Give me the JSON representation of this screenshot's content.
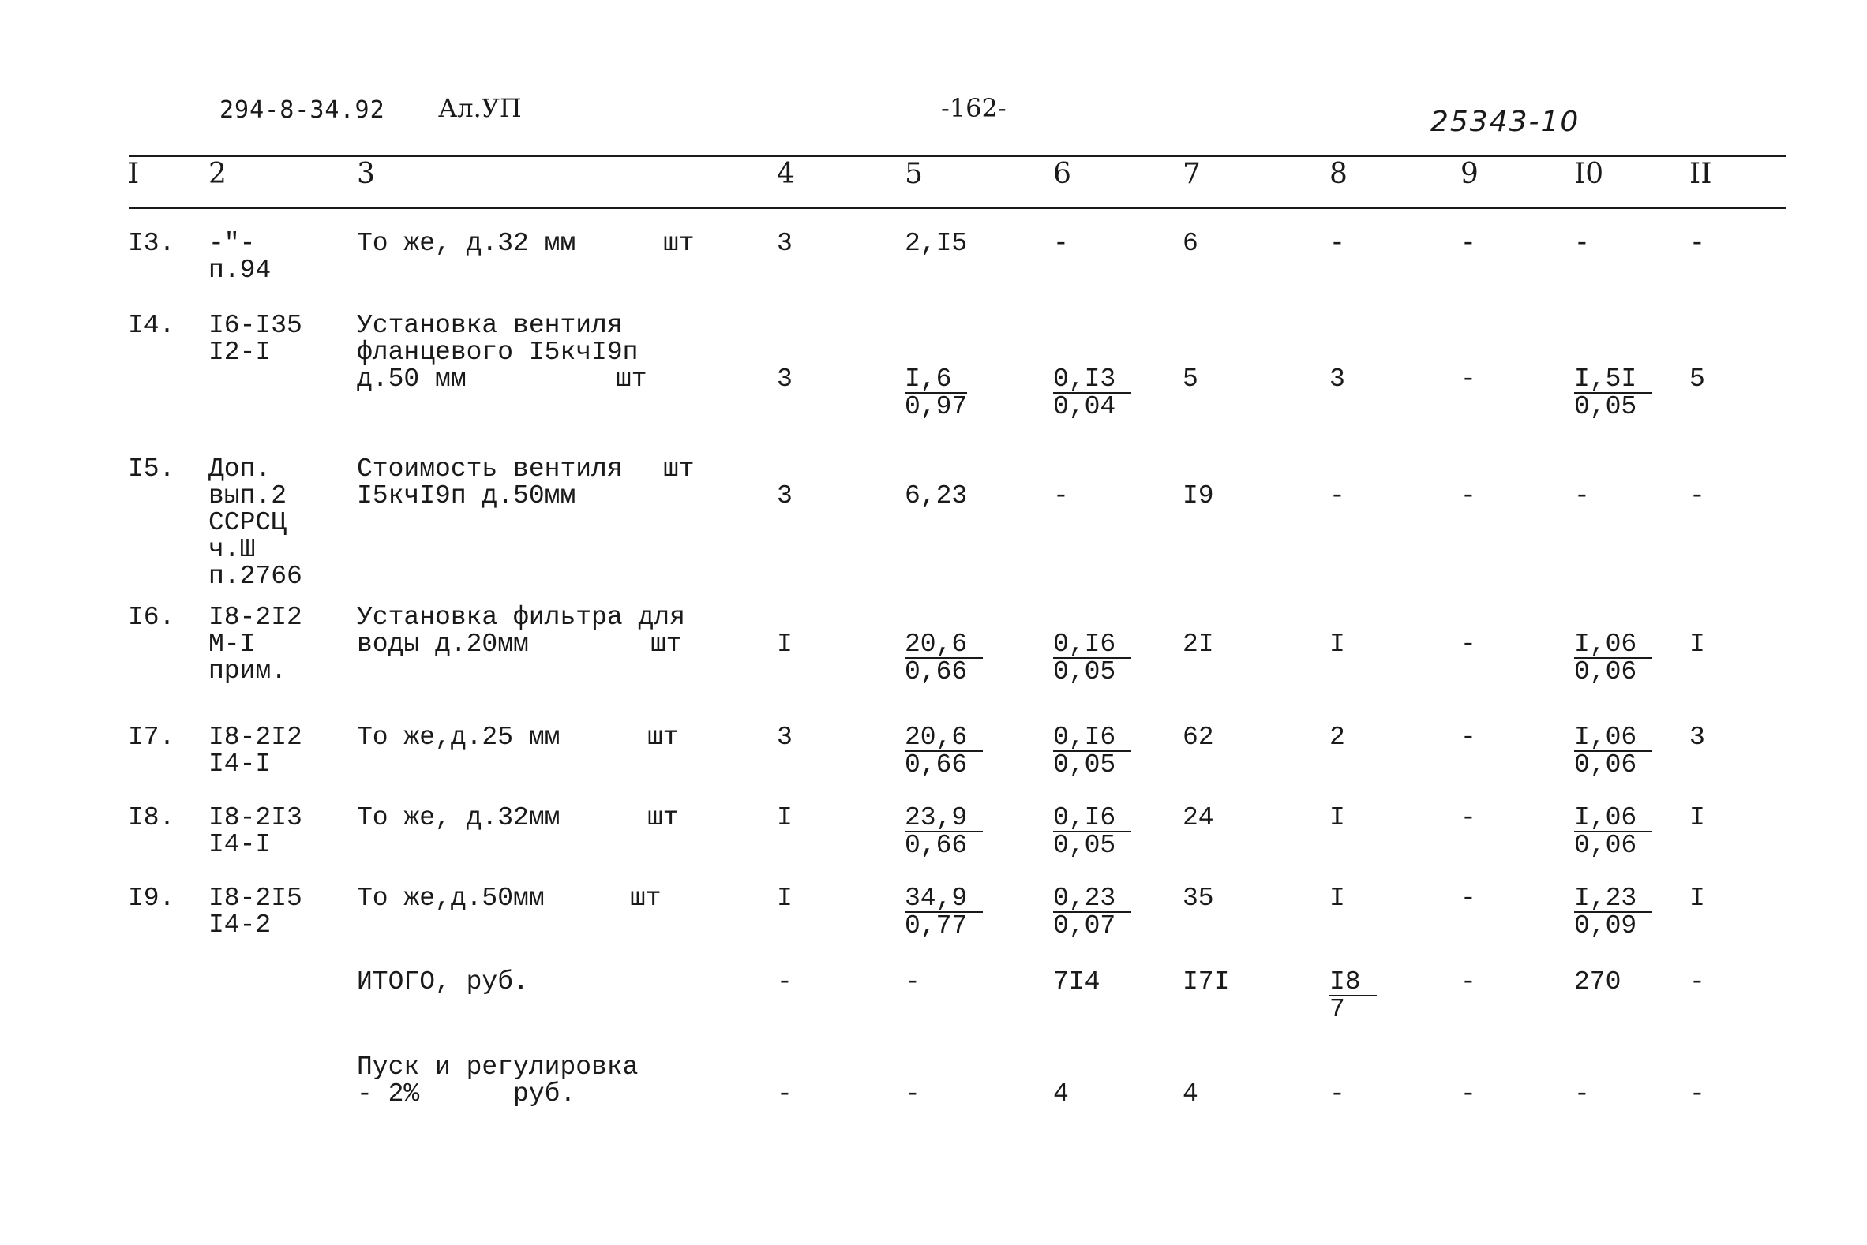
{
  "header": {
    "doc_code": "294-8-34.92",
    "album": "Ал.УП",
    "page_number": "-162-",
    "stamp": "25343-10"
  },
  "columns": [
    "I",
    "2",
    "3",
    "4",
    "5",
    "6",
    "7",
    "8",
    "9",
    "I0",
    "II"
  ],
  "rows": [
    {
      "num": "I3.",
      "ref": [
        "-\"-",
        "п.94"
      ],
      "desc": [
        "То же, д.32 мм"
      ],
      "unit": "шт",
      "c4": "3",
      "c5": {
        "value": "2,I5"
      },
      "c6": {
        "value": "-"
      },
      "c7": "6",
      "c8": {
        "value": "-"
      },
      "c9": "-",
      "c10": {
        "value": "-"
      },
      "c11": "-"
    },
    {
      "num": "I4.",
      "ref": [
        "I6-I35",
        "I2-I"
      ],
      "desc": [
        "Установка вентиля",
        "фланцевого I5кчI9п",
        "д.50 мм"
      ],
      "unit": "шт",
      "c4": "3",
      "c5": {
        "num": "I,6",
        "den": "0,97"
      },
      "c6": {
        "num": "0,I3",
        "den": "0,04"
      },
      "c7": "5",
      "c8": {
        "value": "3"
      },
      "c9": "-",
      "c10": {
        "num": "I,5I",
        "den": "0,05"
      },
      "c11": "5"
    },
    {
      "num": "I5.",
      "ref": [
        "Доп.",
        "вып.2",
        "ССРСЦ",
        "ч.Ш",
        "п.2766"
      ],
      "desc": [
        "Стоимость вентиля",
        "I5кчI9п д.50мм"
      ],
      "unit": "шт",
      "c4": "3",
      "c5": {
        "value": "6,23"
      },
      "c6": {
        "value": "-"
      },
      "c7": "I9",
      "c8": {
        "value": "-"
      },
      "c9": "-",
      "c10": {
        "value": "-"
      },
      "c11": "-"
    },
    {
      "num": "I6.",
      "ref": [
        "I8-2I2",
        "М-I",
        "прим."
      ],
      "desc": [
        "Установка фильтра для",
        "воды д.20мм"
      ],
      "unit": "шт",
      "c4": "I",
      "c5": {
        "num": "20,6",
        "den": "0,66"
      },
      "c6": {
        "num": "0,I6",
        "den": "0,05"
      },
      "c7": "2I",
      "c8": {
        "value": "I"
      },
      "c9": "-",
      "c10": {
        "num": "I,06",
        "den": "0,06"
      },
      "c11": "I"
    },
    {
      "num": "I7.",
      "ref": [
        "I8-2I2",
        "I4-I"
      ],
      "desc": [
        "То же,д.25 мм"
      ],
      "unit": "шт",
      "c4": "3",
      "c5": {
        "num": "20,6",
        "den": "0,66"
      },
      "c6": {
        "num": "0,I6",
        "den": "0,05"
      },
      "c7": "62",
      "c8": {
        "value": "2"
      },
      "c9": "-",
      "c10": {
        "num": "I,06",
        "den": "0,06"
      },
      "c11": "3"
    },
    {
      "num": "I8.",
      "ref": [
        "I8-2I3",
        "I4-I"
      ],
      "desc": [
        "То же, д.32мм"
      ],
      "unit": "шт",
      "c4": "I",
      "c5": {
        "num": "23,9",
        "den": "0,66"
      },
      "c6": {
        "num": "0,I6",
        "den": "0,05"
      },
      "c7": "24",
      "c8": {
        "value": "I"
      },
      "c9": "-",
      "c10": {
        "num": "I,06",
        "den": "0,06"
      },
      "c11": "I"
    },
    {
      "num": "I9.",
      "ref": [
        "I8-2I5",
        "I4-2"
      ],
      "desc": [
        "То же,д.50мм"
      ],
      "unit": "шт",
      "c4": "I",
      "c5": {
        "num": "34,9",
        "den": "0,77"
      },
      "c6": {
        "num": "0,23",
        "den": "0,07"
      },
      "c7": "35",
      "c8": {
        "value": "I"
      },
      "c9": "-",
      "c10": {
        "num": "I,23",
        "den": "0,09"
      },
      "c11": "I"
    }
  ],
  "totals": [
    {
      "label": [
        "ИТОГО, руб."
      ],
      "c4": "-",
      "c5": "-",
      "c6": "7I4",
      "c7": "I7I",
      "c8": {
        "num": "I8",
        "den": "7"
      },
      "c9": "-",
      "c10": "270",
      "c11": "-"
    },
    {
      "label": [
        "Пуск и регулировка",
        "- 2%      руб."
      ],
      "c4": "-",
      "c5": "-",
      "c6": "4",
      "c7": "4",
      "c8": {
        "value": "-"
      },
      "c9": "-",
      "c10": "-",
      "c11": "-"
    }
  ]
}
